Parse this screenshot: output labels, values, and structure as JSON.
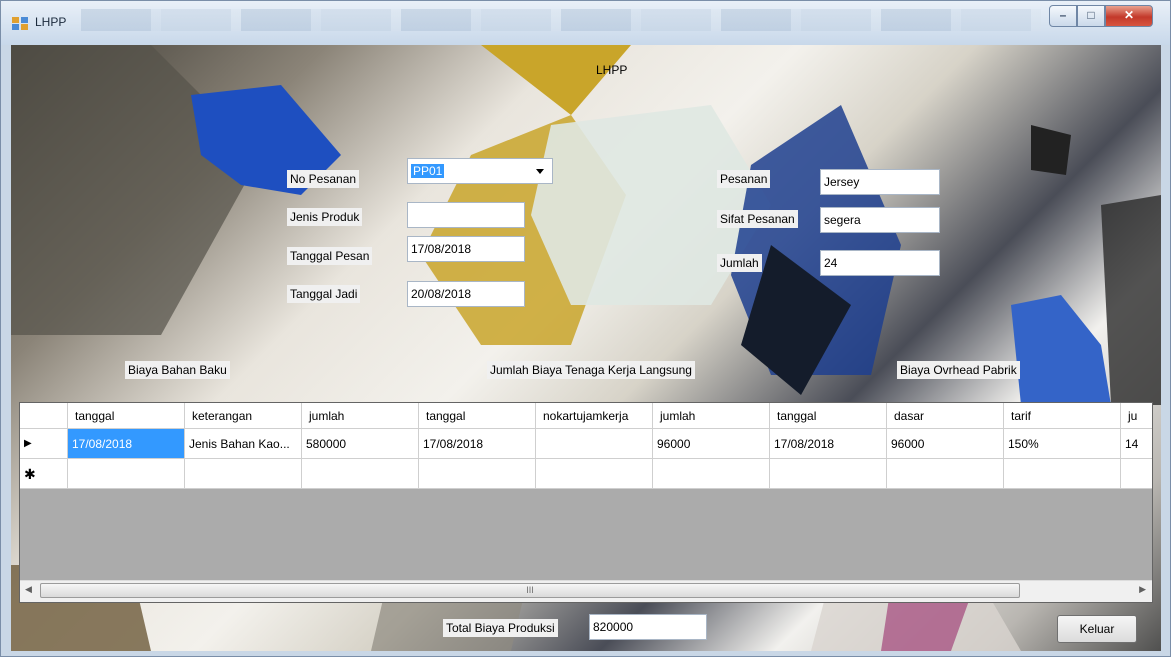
{
  "window": {
    "title": "LHPP"
  },
  "form": {
    "heading": "LHPP",
    "no_pesanan": {
      "label": "No Pesanan",
      "value": "PP01"
    },
    "jenis_produk": {
      "label": "Jenis Produk",
      "value": ""
    },
    "tanggal_pesan": {
      "label": "Tanggal Pesan",
      "value": "17/08/2018"
    },
    "tanggal_jadi": {
      "label": "Tanggal Jadi",
      "value": "20/08/2018"
    },
    "pesanan": {
      "label": "Pesanan",
      "value": "Jersey"
    },
    "sifat_pesanan": {
      "label": "Sifat Pesanan",
      "value": "segera"
    },
    "jumlah": {
      "label": "Jumlah",
      "value": "24"
    }
  },
  "sections": {
    "bahan_baku": "Biaya Bahan Baku",
    "tenaga_kerja": "Jumlah Biaya Tenaga Kerja Langsung",
    "overhead": "Biaya Ovrhead Pabrik"
  },
  "grid": {
    "columns": [
      "tanggal",
      "keterangan",
      "jumlah",
      "tanggal",
      "nokartujamkerja",
      "jumlah",
      "tanggal",
      "dasar",
      "tarif",
      "ju"
    ],
    "rows": [
      [
        "17/08/2018",
        "Jenis Bahan Kao...",
        "580000",
        "17/08/2018",
        "",
        "96000",
        "17/08/2018",
        "96000",
        "150%",
        "14"
      ]
    ],
    "row_marker_current": "▶",
    "row_marker_new": "✱",
    "scroll_grip": "III"
  },
  "footer": {
    "total_label": "Total Biaya Produksi",
    "total_value": "820000",
    "keluar_button": "Keluar"
  },
  "colors": {
    "selection": "#3399ff",
    "grid_bg": "#ababab",
    "close_button": "#c3392b"
  },
  "icons": {
    "app": "window-app-icon",
    "minimize": "minimize-icon",
    "maximize": "maximize-icon",
    "close": "close-icon"
  }
}
